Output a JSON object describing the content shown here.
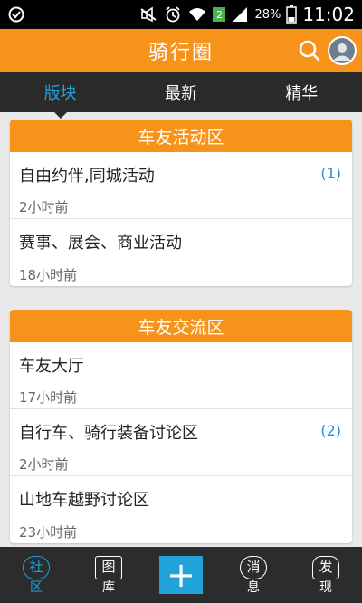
{
  "status_bar": {
    "battery_percent": "28%",
    "sim_label": "2",
    "time": "11:02"
  },
  "header": {
    "title": "骑行圈"
  },
  "tabs": [
    {
      "label": "版块",
      "active": true
    },
    {
      "label": "最新",
      "active": false
    },
    {
      "label": "精华",
      "active": false
    }
  ],
  "sections": [
    {
      "title": "车友活动区",
      "items": [
        {
          "name": "自由约伴,同城活动",
          "time": "2小时前",
          "count": "(1)"
        },
        {
          "name": "赛事、展会、商业活动",
          "time": "18小时前",
          "count": ""
        }
      ]
    },
    {
      "title": "车友交流区",
      "items": [
        {
          "name": "车友大厅",
          "time": "17小时前",
          "count": ""
        },
        {
          "name": "自行车、骑行装备讨论区",
          "time": "2小时前",
          "count": "(2)"
        },
        {
          "name": "山地车越野讨论区",
          "time": "23小时前",
          "count": ""
        }
      ]
    }
  ],
  "bottom_nav": {
    "items": [
      {
        "glyph": "社",
        "label": "区",
        "active": true
      },
      {
        "glyph": "图",
        "label": "库",
        "active": false
      },
      {
        "glyph": "消",
        "label": "息",
        "active": false
      },
      {
        "glyph": "发",
        "label": "现",
        "active": false
      }
    ],
    "add_symbol": "+"
  },
  "colors": {
    "header_orange": "#f7931a",
    "accent_blue": "#1fa3d8",
    "dark_bar": "#2a2a2a"
  }
}
